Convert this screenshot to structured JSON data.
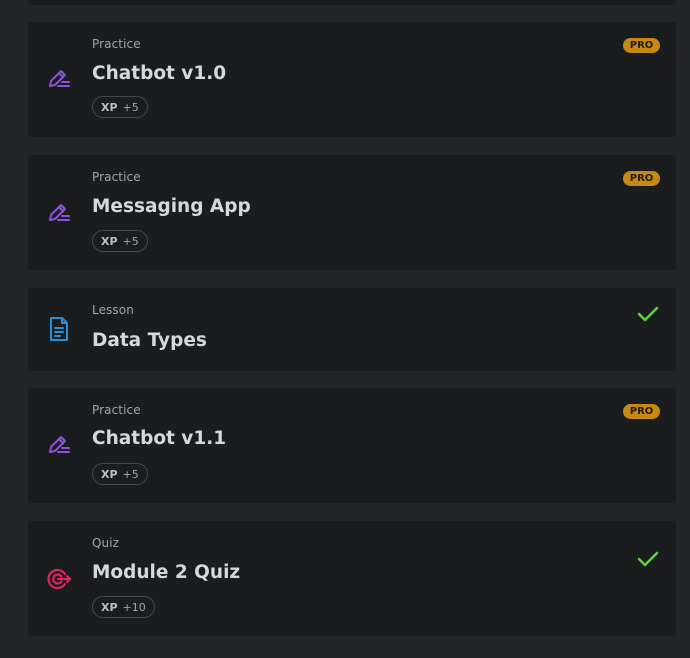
{
  "colors": {
    "page_bg": "#232426",
    "card_bg": "#1b1c1e",
    "practice_icon": "#8a55d8",
    "lesson_icon": "#2a8fd8",
    "quiz_icon": "#e0245e",
    "pro_badge": "#c68a12",
    "check": "#5fcf45"
  },
  "items": [
    {
      "type_label": "Practice",
      "title": "Chatbot v1.0",
      "icon": "pencil-edit-icon",
      "xp_label": "XP",
      "xp_value": "+5",
      "badge": "PRO"
    },
    {
      "type_label": "Practice",
      "title": "Messaging App",
      "icon": "pencil-edit-icon",
      "xp_label": "XP",
      "xp_value": "+5",
      "badge": "PRO"
    },
    {
      "type_label": "Lesson",
      "title": "Data Types",
      "icon": "document-icon",
      "status": "completed"
    },
    {
      "type_label": "Practice",
      "title": "Chatbot v1.1",
      "icon": "pencil-edit-icon",
      "xp_label": "XP",
      "xp_value": "+5",
      "badge": "PRO"
    },
    {
      "type_label": "Quiz",
      "title": "Module 2 Quiz",
      "icon": "target-icon",
      "xp_label": "XP",
      "xp_value": "+10",
      "status": "completed"
    }
  ]
}
